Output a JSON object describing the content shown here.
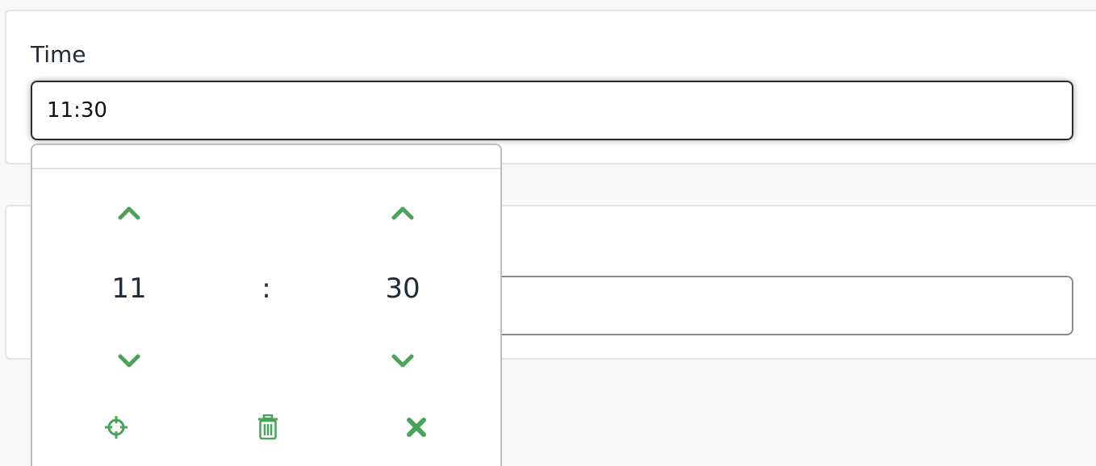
{
  "form": {
    "time_label": "Time",
    "time_value": "11:30"
  },
  "picker": {
    "hours": "11",
    "separator": ":",
    "minutes": "30",
    "accent_color": "#4aa35a",
    "icons": {
      "increment_hours": "chevron-up-icon",
      "increment_minutes": "chevron-up-icon",
      "decrement_hours": "chevron-down-icon",
      "decrement_minutes": "chevron-down-icon",
      "now": "crosshairs-icon",
      "clear": "trash-icon",
      "close": "close-icon"
    }
  }
}
